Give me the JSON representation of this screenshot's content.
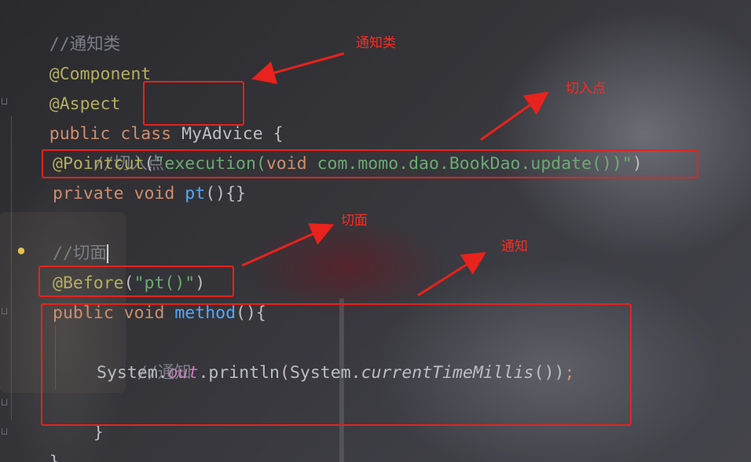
{
  "code": {
    "line_notify_comment": "//通知类",
    "line_component": "@Component",
    "line_aspect": "@Aspect",
    "class_decl": {
      "kw_public": "public",
      "kw_class": "class",
      "class_name": "MyAdvice",
      "brace_open": "{"
    },
    "pointcut_comment": "//切入点",
    "pointcut_line": {
      "annotation": "@Pointcut",
      "paren_open": "(",
      "quote_open": "\"",
      "string_exec": "execution",
      "str_paren_open": "(",
      "kw_void": "void",
      "str_target": " com.momo.dao.BookDao.update",
      "str_parens": "()",
      "str_paren_close": ")",
      "quote_close": "\"",
      "paren_close": ")"
    },
    "pt_method": {
      "kw_private": "private",
      "kw_void": "void",
      "name": "pt",
      "rest": "(){}"
    },
    "aspect_comment": "//切面",
    "before_line": {
      "annotation": "@Before",
      "paren_open": "(",
      "string": "\"pt()\"",
      "paren_close": ")"
    },
    "method_decl": {
      "kw_public": "public",
      "kw_void": "void",
      "name": "method",
      "rest": "(){"
    },
    "advice_comment": "//通知",
    "println_line": {
      "system1": "System.",
      "out": "out",
      "println": ".println(System.",
      "current": "currentTimeMillis",
      "tail": "())",
      "semicolon": ";"
    },
    "method_close": "}",
    "class_close": "}"
  },
  "callouts": {
    "notify_class": "通知类",
    "pointcut": "切入点",
    "aspect": "切面",
    "advice": "通知"
  },
  "colors": {
    "highlight_box": "#e8221c",
    "callout_text": "#ff2a1f",
    "annotation": "#b3ae60",
    "keyword": "#cf8e6d",
    "string": "#6aab73",
    "comment": "#7a7e85",
    "method": "#56a8f5",
    "static_field": "#c77dbb"
  },
  "icons": {
    "gutter": "lightbulb-icon"
  }
}
